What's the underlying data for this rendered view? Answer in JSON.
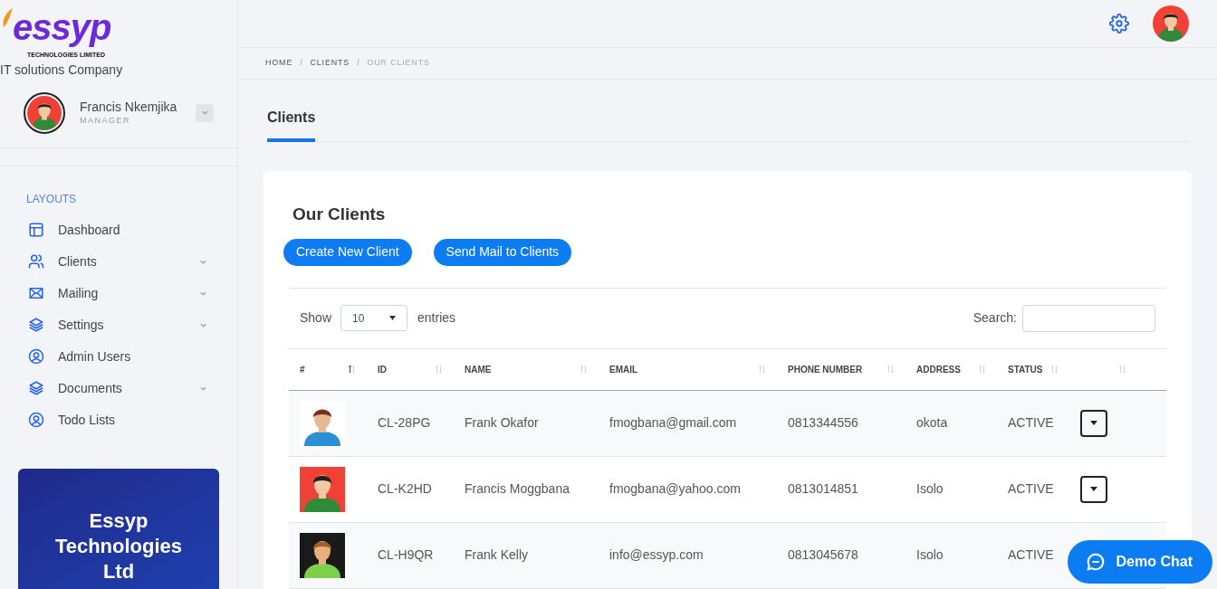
{
  "sidebar": {
    "logo": {
      "wordmark": "essyp",
      "subtitle": "TECHNOLOGIES LIMITED"
    },
    "tagline": "IT solutions Company",
    "user": {
      "name": "Francis Nkemjika",
      "role": "MANAGER"
    },
    "section": "LAYOUTS",
    "items": [
      {
        "label": "Dashboard",
        "kind": "layout",
        "expandable": false
      },
      {
        "label": "Clients",
        "kind": "users",
        "expandable": true
      },
      {
        "label": "Mailing",
        "kind": "mail",
        "expandable": true
      },
      {
        "label": "Settings",
        "kind": "layers",
        "expandable": true
      },
      {
        "label": "Admin Users",
        "kind": "user",
        "expandable": false
      },
      {
        "label": "Documents",
        "kind": "layers",
        "expandable": true
      },
      {
        "label": "Todo Lists",
        "kind": "user",
        "expandable": false
      }
    ],
    "promo": "Essyp Technologies Ltd"
  },
  "breadcrumb": [
    {
      "label": "HOME",
      "current": false
    },
    {
      "label": "CLIENTS",
      "current": false
    },
    {
      "label": "OUR CLIENTS",
      "current": true
    }
  ],
  "breadcrumb_separator": "/",
  "page_tab": "Clients",
  "card": {
    "title": "Our Clients",
    "buttons": [
      "Create New Client",
      "Send Mail to Clients"
    ],
    "show_label": "Show",
    "page_size": "10",
    "entries_label": "entries",
    "search_label": "Search:",
    "columns": [
      {
        "label": "#",
        "sorted": true
      },
      {
        "label": "ID",
        "sorted": false
      },
      {
        "label": "NAME",
        "sorted": false
      },
      {
        "label": "EMAIL",
        "sorted": false
      },
      {
        "label": "PHONE NUMBER",
        "sorted": false
      },
      {
        "label": "ADDRESS",
        "sorted": false
      },
      {
        "label": "STATUS",
        "sorted": false
      },
      {
        "sorted": false
      }
    ],
    "rows": [
      {
        "id": "CL-28PG",
        "name": "Frank Okafor",
        "email": "fmogbana@gmail.com",
        "phone": "0813344556",
        "address": "okota",
        "status": "ACTIVE"
      },
      {
        "id": "CL-K2HD",
        "name": "Francis Moggbana",
        "email": "fmogbana@yahoo.com",
        "phone": "0813014851",
        "address": "Isolo",
        "status": "ACTIVE"
      },
      {
        "id": "CL-H9QR",
        "name": "Frank Kelly",
        "email": "info@essyp.com",
        "phone": "0813045678",
        "address": "Isolo",
        "status": "ACTIVE"
      }
    ]
  },
  "chat_button": "Demo Chat"
}
